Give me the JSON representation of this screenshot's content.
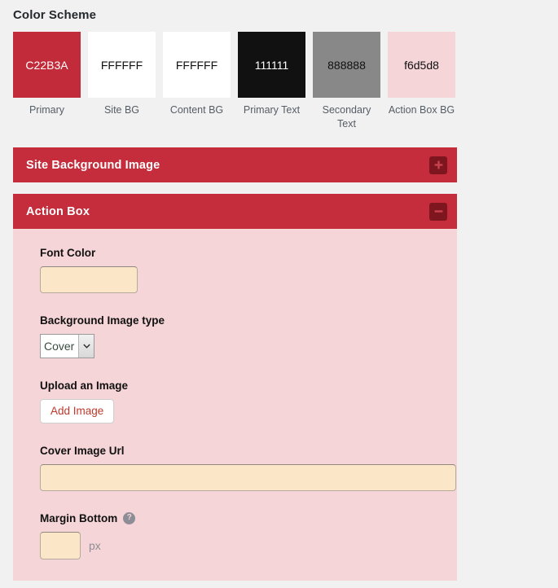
{
  "color_scheme": {
    "title": "Color Scheme",
    "swatches": [
      {
        "value": "C22B3A",
        "label": "Primary",
        "bg": "#c22b3a",
        "fg": "#ffffff"
      },
      {
        "value": "FFFFFF",
        "label": "Site BG",
        "bg": "#ffffff",
        "fg": "#111111"
      },
      {
        "value": "FFFFFF",
        "label": "Content BG",
        "bg": "#ffffff",
        "fg": "#111111"
      },
      {
        "value": "111111",
        "label": "Primary Text",
        "bg": "#111111",
        "fg": "#ffffff"
      },
      {
        "value": "888888",
        "label": "Secondary Text",
        "bg": "#888888",
        "fg": "#111111"
      },
      {
        "value": "f6d5d8",
        "label": "Action Box BG",
        "bg": "#f6d5d8",
        "fg": "#111111"
      }
    ]
  },
  "panels": {
    "site_background_image": {
      "title": "Site Background Image",
      "toggle_icon": "plus-icon",
      "expanded": false
    },
    "action_box": {
      "title": "Action Box",
      "toggle_icon": "minus-icon",
      "expanded": true,
      "fields": {
        "font_color": {
          "label": "Font Color",
          "value": "",
          "placeholder": ""
        },
        "background_image_type": {
          "label": "Background Image type",
          "selected": "Cover",
          "options": [
            "Cover"
          ],
          "arrow_icon": "chevron-down-icon"
        },
        "upload_image": {
          "label": "Upload an Image",
          "button_label": "Add Image"
        },
        "cover_image_url": {
          "label": "Cover Image Url",
          "value": "",
          "placeholder": ""
        },
        "margin_bottom": {
          "label": "Margin Bottom",
          "help_icon": "help-icon",
          "help_glyph": "?",
          "value": "",
          "unit": "px"
        }
      }
    }
  },
  "colors": {
    "panel_header_bg": "#c62d3c",
    "panel_body_bg": "#f6d5d8",
    "toggle_bg": "#7e1620",
    "page_bg": "#f1f1f1",
    "input_autofill": "#fbe6c8",
    "accent_link": "#c0392b"
  }
}
